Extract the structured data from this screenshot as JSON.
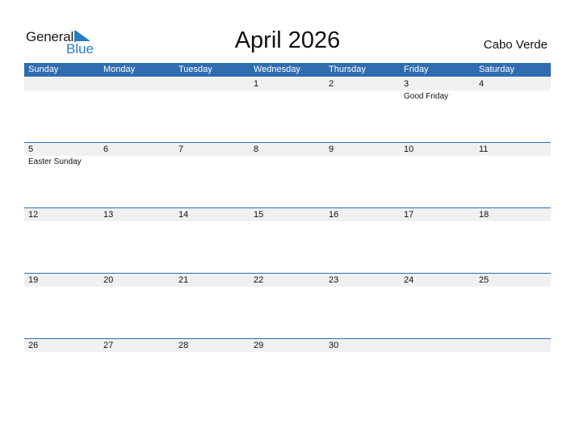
{
  "logo": {
    "general": "General",
    "blue": "Blue",
    "brand_color": "#2a7cc6"
  },
  "title": "April 2026",
  "country": "Cabo Verde",
  "header_color": "#2f6db0",
  "days_of_week": [
    "Sunday",
    "Monday",
    "Tuesday",
    "Wednesday",
    "Thursday",
    "Friday",
    "Saturday"
  ],
  "weeks": [
    {
      "days": [
        {
          "num": "",
          "event": ""
        },
        {
          "num": "",
          "event": ""
        },
        {
          "num": "",
          "event": ""
        },
        {
          "num": "1",
          "event": ""
        },
        {
          "num": "2",
          "event": ""
        },
        {
          "num": "3",
          "event": "Good Friday"
        },
        {
          "num": "4",
          "event": ""
        }
      ]
    },
    {
      "days": [
        {
          "num": "5",
          "event": "Easter Sunday"
        },
        {
          "num": "6",
          "event": ""
        },
        {
          "num": "7",
          "event": ""
        },
        {
          "num": "8",
          "event": ""
        },
        {
          "num": "9",
          "event": ""
        },
        {
          "num": "10",
          "event": ""
        },
        {
          "num": "11",
          "event": ""
        }
      ]
    },
    {
      "days": [
        {
          "num": "12",
          "event": ""
        },
        {
          "num": "13",
          "event": ""
        },
        {
          "num": "14",
          "event": ""
        },
        {
          "num": "15",
          "event": ""
        },
        {
          "num": "16",
          "event": ""
        },
        {
          "num": "17",
          "event": ""
        },
        {
          "num": "18",
          "event": ""
        }
      ]
    },
    {
      "days": [
        {
          "num": "19",
          "event": ""
        },
        {
          "num": "20",
          "event": ""
        },
        {
          "num": "21",
          "event": ""
        },
        {
          "num": "22",
          "event": ""
        },
        {
          "num": "23",
          "event": ""
        },
        {
          "num": "24",
          "event": ""
        },
        {
          "num": "25",
          "event": ""
        }
      ]
    },
    {
      "days": [
        {
          "num": "26",
          "event": ""
        },
        {
          "num": "27",
          "event": ""
        },
        {
          "num": "28",
          "event": ""
        },
        {
          "num": "29",
          "event": ""
        },
        {
          "num": "30",
          "event": ""
        },
        {
          "num": "",
          "event": ""
        },
        {
          "num": "",
          "event": ""
        }
      ]
    }
  ]
}
